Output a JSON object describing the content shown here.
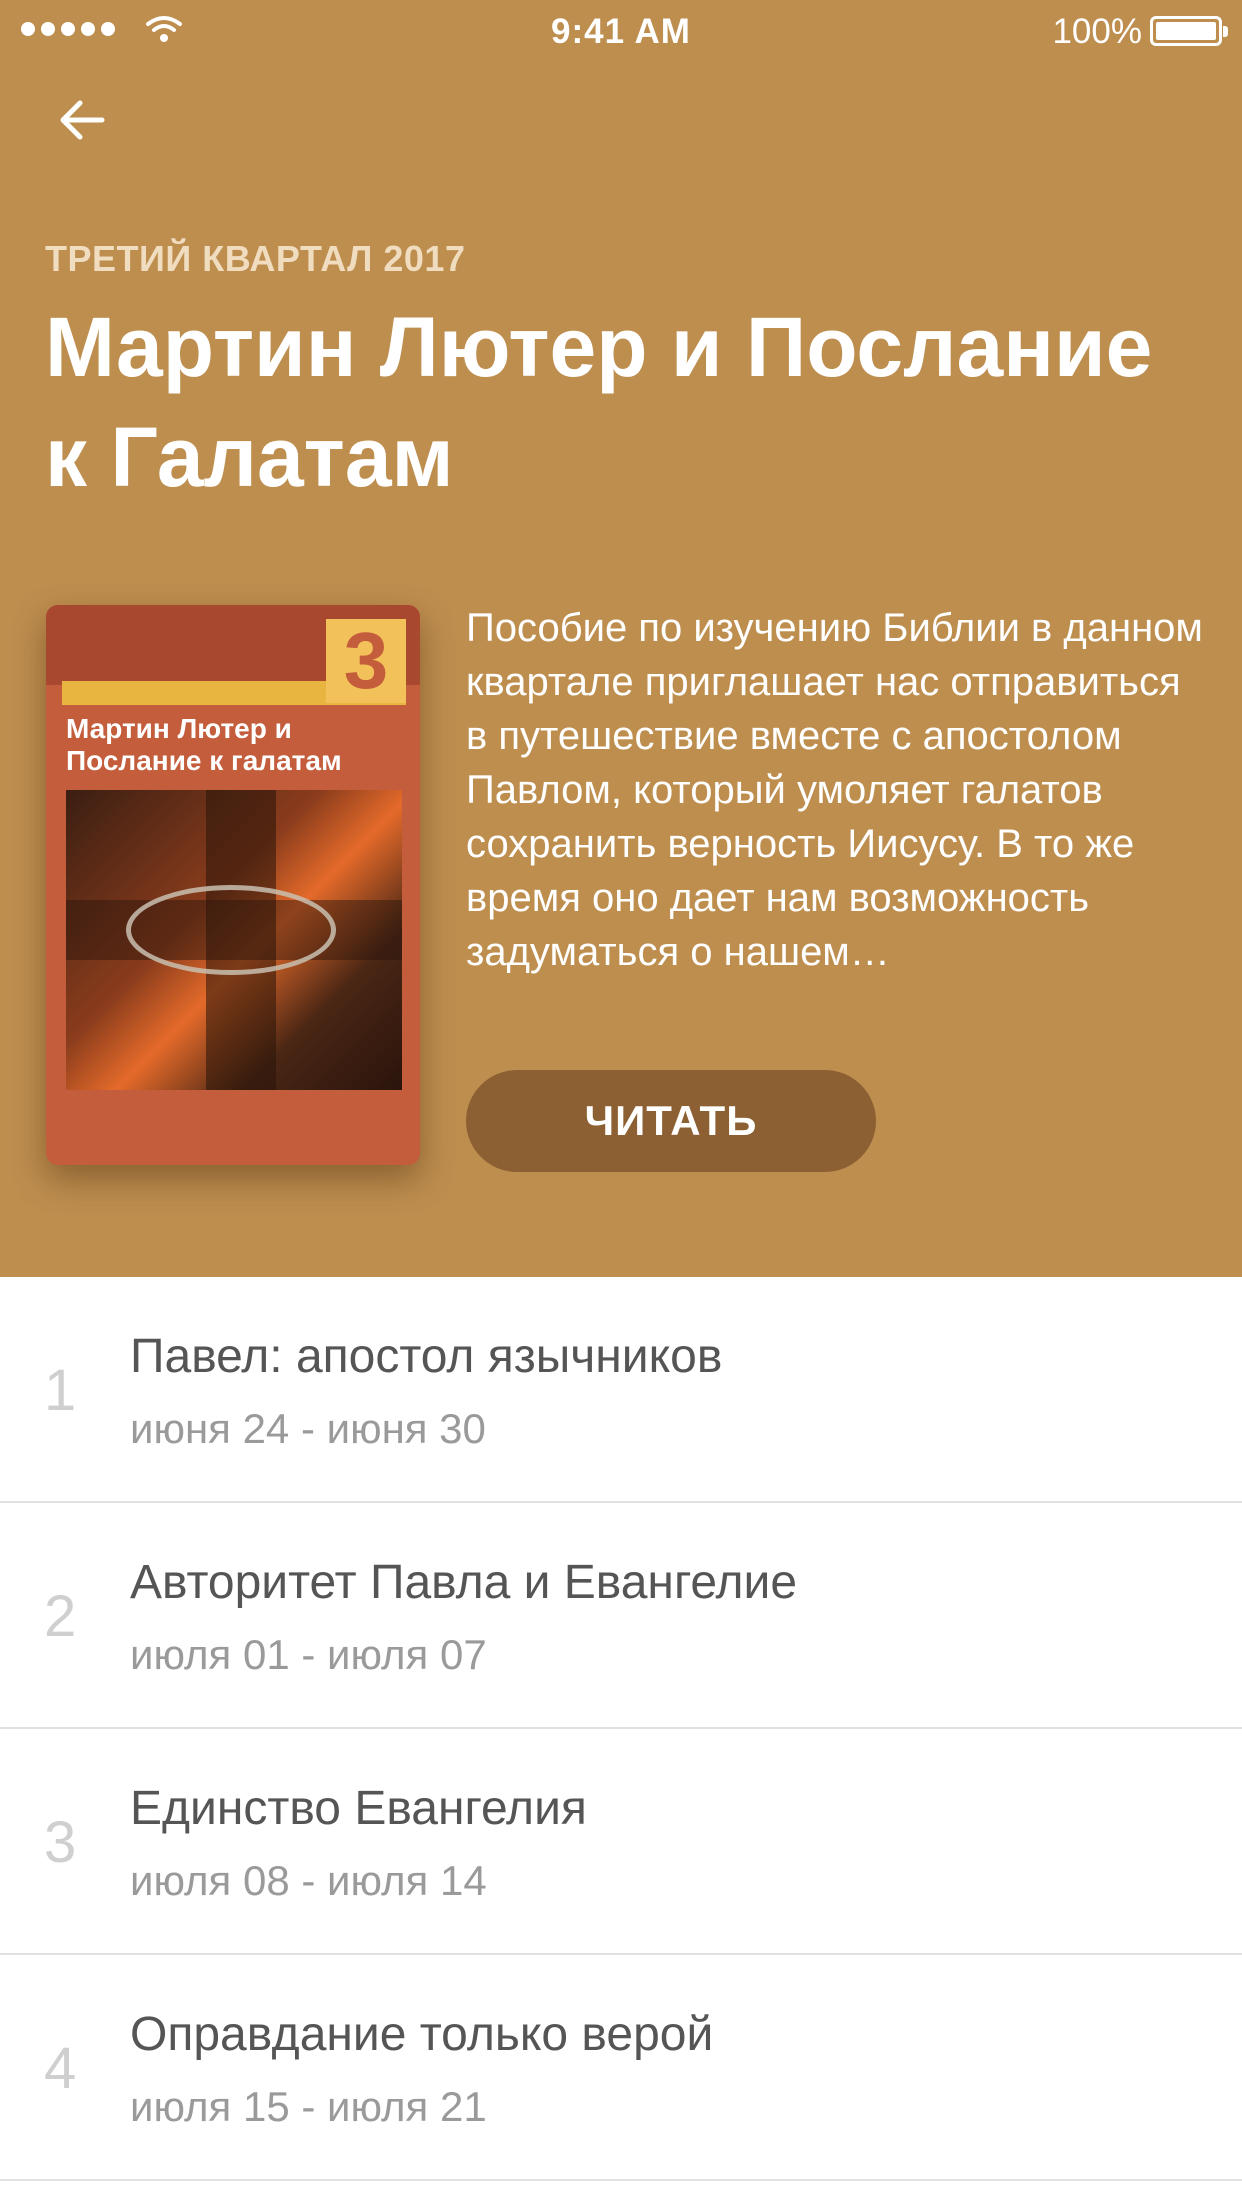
{
  "status_bar": {
    "time": "9:41 AM",
    "battery_percent": "100%",
    "icons": [
      "signal-dots-icon",
      "wifi-icon",
      "battery-icon"
    ]
  },
  "header": {
    "background_color": "#be8e4f",
    "back_icon": "arrow-left-icon",
    "quarter_label": "ТРЕТИЙ КВАРТАЛ 2017",
    "title": "Мартин Лютер и Послание к Галатам",
    "description": "Пособие по изучению Библии в данном квартале приглашает нас отправиться в путешествие вместе с апостолом Павлом, который умоляет галатов сохранить верность Иисусу. В то же время оно дает нам возможность задуматься о нашем…",
    "read_button_label": "ЧИТАТЬ",
    "read_button_color": "#8c6032"
  },
  "cover": {
    "number": "3",
    "title": "Мартин Лютер и Послание к галатам"
  },
  "lessons": [
    {
      "number": "1",
      "title": "Павел: апостол язычников",
      "dates": "июня 24 - июня 30"
    },
    {
      "number": "2",
      "title": "Авторитет Павла и Евангелие",
      "dates": "июля 01 - июля 07"
    },
    {
      "number": "3",
      "title": "Единство Евангелия",
      "dates": "июля 08 - июля 14"
    },
    {
      "number": "4",
      "title": "Оправдание только верой",
      "dates": "июля 15 - июля 21"
    }
  ]
}
